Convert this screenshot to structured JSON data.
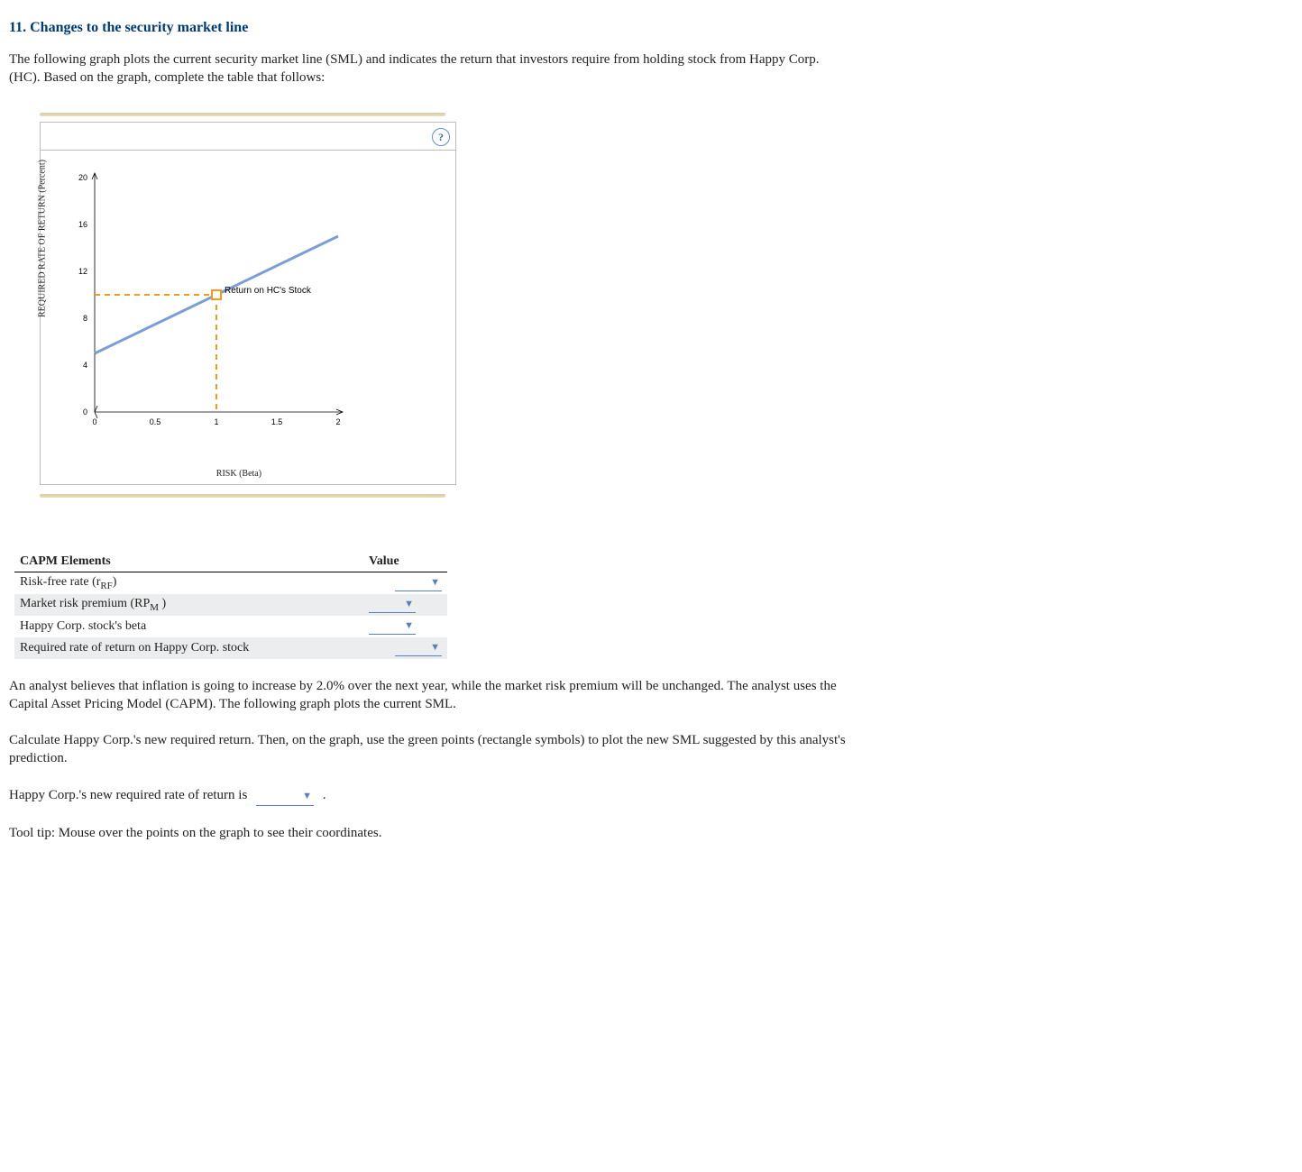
{
  "question_title": "11. Changes to the security market line",
  "intro": "The following graph plots the current security market line (SML) and indicates the return that investors require from holding stock from Happy Corp. (HC). Based on the graph, complete the table that follows:",
  "chart_data": {
    "type": "line",
    "title": "",
    "xlabel": "RISK (Beta)",
    "ylabel": "REQUIRED RATE OF RETURN (Percent)",
    "x_ticks": [
      0,
      0.5,
      1.0,
      1.5,
      2.0
    ],
    "y_ticks": [
      0,
      4.0,
      8.0,
      12.0,
      16.0,
      20.0
    ],
    "xlim": [
      0,
      2.0
    ],
    "ylim": [
      0,
      20.0
    ],
    "series": [
      {
        "name": "SML",
        "color": "#7a9ed6",
        "x": [
          0,
          2.0
        ],
        "y": [
          5.0,
          15.0
        ]
      }
    ],
    "guides": [
      {
        "name": "hc_horizontal",
        "style": "dashed",
        "color": "#f49b1c",
        "x": [
          0,
          1.0
        ],
        "y": [
          10.0,
          10.0
        ]
      },
      {
        "name": "hc_vertical",
        "style": "dashed",
        "color": "#f49b1c",
        "x": [
          1.0,
          1.0
        ],
        "y": [
          0,
          10.0
        ]
      }
    ],
    "annotations": [
      {
        "label": "Return on HC's Stock",
        "x": 1.0,
        "y": 10.0,
        "marker": "square"
      }
    ]
  },
  "help_icon": "?",
  "table": {
    "headers": [
      "CAPM Elements",
      "Value"
    ],
    "rows": [
      {
        "label": "Risk-free rate (r",
        "sub": "RF",
        "label_after": ")"
      },
      {
        "label": "Market risk premium (RP",
        "sub": "M",
        "label_after": " )"
      },
      {
        "label": "Happy Corp. stock's beta",
        "sub": "",
        "label_after": ""
      },
      {
        "label": "Required rate of return on Happy Corp. stock",
        "sub": "",
        "label_after": ""
      }
    ]
  },
  "para_analyst": "An analyst believes that inflation is going to increase by 2.0% over the next year, while the market risk premium will be unchanged. The analyst uses the Capital Asset Pricing Model (CAPM). The following graph plots the current SML.",
  "para_calc": "Calculate Happy Corp.'s new required return. Then, on the graph, use the green points (rectangle symbols) to plot the new SML suggested by this analyst's prediction.",
  "fill_in_sentence_pre": "Happy Corp.'s new required rate of return is",
  "fill_in_sentence_post": ".",
  "tool_tip": "Tool tip: Mouse over the points on the graph to see their coordinates."
}
